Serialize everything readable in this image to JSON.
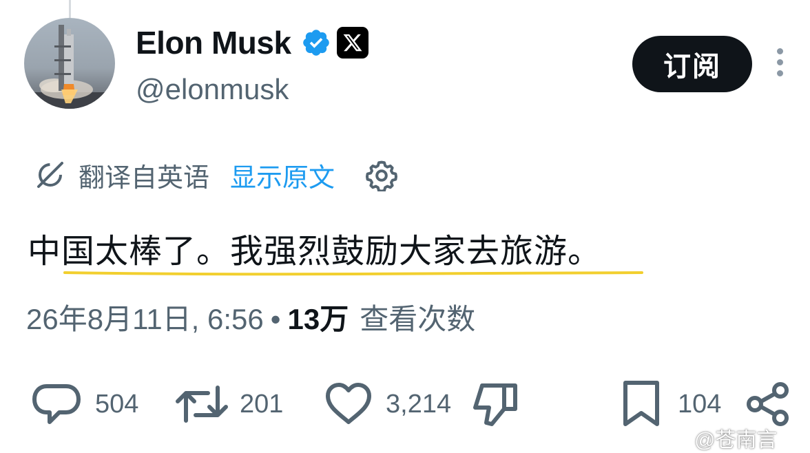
{
  "author": {
    "name": "Elon Musk",
    "handle": "@elonmusk",
    "verified_icon": "verified-badge-icon",
    "affiliate_icon": "x-logo-icon",
    "avatar_icon": "rocket-launch-avatar"
  },
  "header": {
    "subscribe_label": "订阅",
    "more_icon": "more-vertical-icon"
  },
  "translation": {
    "label": "翻译自英语",
    "show_original": "显示原文",
    "icon": "translate-icon",
    "settings_icon": "gear-icon"
  },
  "tweet": {
    "text": "中国太棒了。我强烈鼓励大家去旅游。",
    "date": "26年8月11日, 6:56",
    "separator": "•",
    "views": "13万",
    "views_label": "查看次数"
  },
  "actions": {
    "reply_count": "504",
    "retweet_count": "201",
    "like_count": "3,214",
    "bookmark_count": "104"
  },
  "watermark": "@苍南言",
  "colors": {
    "text": "#0f1419",
    "secondary": "#536471",
    "link": "#1d9bf0",
    "verified": "#1d9bf0",
    "highlight": "#f2cf2e"
  }
}
